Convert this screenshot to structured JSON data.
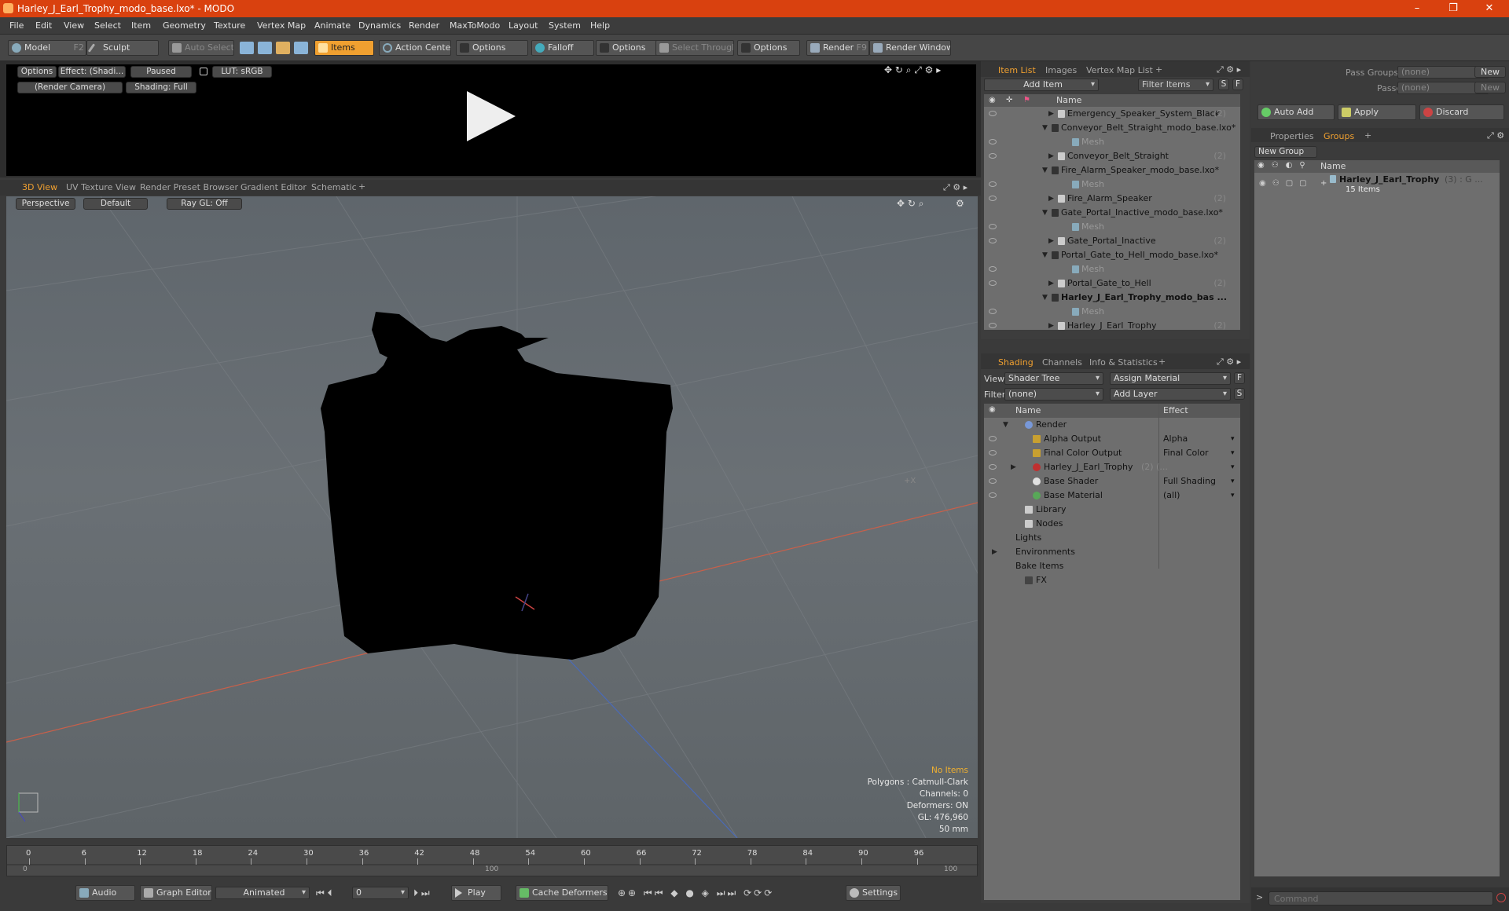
{
  "window": {
    "title": "Harley_J_Earl_Trophy_modo_base.lxo* - MODO",
    "minimize": "–",
    "restore": "❐",
    "close": "✕"
  },
  "menu": [
    "File",
    "Edit",
    "View",
    "Select",
    "Item",
    "Geometry",
    "Texture",
    "Vertex Map",
    "Animate",
    "Dynamics",
    "Render",
    "MaxToModo",
    "Layout",
    "System",
    "Help"
  ],
  "toolbar": {
    "model": "Model",
    "model_key": "F2",
    "sculpt": "Sculpt",
    "auto_select": "Auto Select",
    "items": "Items",
    "action_center": "Action Center",
    "options1": "Options",
    "falloff": "Falloff",
    "options2": "Options",
    "select_through": "Select Through",
    "options3": "Options",
    "render": "Render",
    "render_key": "F9",
    "render_window": "Render Window"
  },
  "preview": {
    "options": "Options",
    "effect": "Effect: (Shadi...",
    "paused": "Paused",
    "lut": "LUT: sRGB",
    "camera": "(Render Camera)",
    "shading": "Shading: Full"
  },
  "view_tabs": [
    "3D View",
    "UV Texture View",
    "Render Preset Browser",
    "Gradient Editor",
    "Schematic",
    "+"
  ],
  "viewport": {
    "perspective": "Perspective",
    "default": "Default",
    "raygl": "Ray GL: Off",
    "info": {
      "items": "No Items",
      "polygons": "Polygons : Catmull-Clark",
      "channels": "Channels: 0",
      "deformers": "Deformers: ON",
      "gl": "GL: 476,960",
      "size": "50 mm"
    }
  },
  "timeline": {
    "ticks": [
      "0",
      "6",
      "12",
      "18",
      "24",
      "30",
      "36",
      "42",
      "48",
      "54",
      "60",
      "66",
      "72",
      "78",
      "84",
      "90",
      "96"
    ],
    "sub": [
      "0",
      "100",
      "100"
    ]
  },
  "transport": {
    "audio": "Audio",
    "graph_editor": "Graph Editor",
    "animated": "Animated",
    "frame": "0",
    "play": "Play",
    "cache": "Cache Deformers",
    "settings": "Settings"
  },
  "item_list": {
    "tabs": [
      "Item List",
      "Images",
      "Vertex Map List",
      "+"
    ],
    "add_item": "Add Item",
    "filter": "Filter Items",
    "s": "S",
    "f": "F",
    "col_name": "Name",
    "rows": [
      {
        "label": "Emergency_Speaker_System_Black",
        "count": "(2)"
      },
      {
        "label": "Conveyor_Belt_Straight_modo_base.lxo*",
        "count": ""
      },
      {
        "label": "Mesh",
        "count": ""
      },
      {
        "label": "Conveyor_Belt_Straight",
        "count": "(2)"
      },
      {
        "label": "Fire_Alarm_Speaker_modo_base.lxo*",
        "count": ""
      },
      {
        "label": "Mesh",
        "count": ""
      },
      {
        "label": "Fire_Alarm_Speaker",
        "count": "(2)"
      },
      {
        "label": "Gate_Portal_Inactive_modo_base.lxo*",
        "count": ""
      },
      {
        "label": "Mesh",
        "count": ""
      },
      {
        "label": "Gate_Portal_Inactive",
        "count": "(2)"
      },
      {
        "label": "Portal_Gate_to_Hell_modo_base.lxo*",
        "count": ""
      },
      {
        "label": "Mesh",
        "count": ""
      },
      {
        "label": "Portal_Gate_to_Hell",
        "count": "(2)"
      },
      {
        "label": "Harley_J_Earl_Trophy_modo_bas ...",
        "count": ""
      },
      {
        "label": "Mesh",
        "count": ""
      },
      {
        "label": "Harley_J_Earl_Trophy",
        "count": "(2)"
      }
    ]
  },
  "shading": {
    "tabs": [
      "Shading",
      "Channels",
      "Info & Statistics",
      "+"
    ],
    "view_label": "View",
    "view_value": "Shader Tree",
    "assign": "Assign Material",
    "f": "F",
    "filter_label": "Filter",
    "filter_value": "(none)",
    "add_layer": "Add Layer",
    "s": "S",
    "col_name": "Name",
    "col_effect": "Effect",
    "rows": [
      {
        "label": "Render",
        "effect": ""
      },
      {
        "label": "Alpha Output",
        "effect": "Alpha"
      },
      {
        "label": "Final Color Output",
        "effect": "Final Color"
      },
      {
        "label": "Harley_J_Earl_Trophy",
        "extra": "(2) (...",
        "effect": ""
      },
      {
        "label": "Base Shader",
        "effect": "Full Shading"
      },
      {
        "label": "Base Material",
        "effect": "(all)"
      },
      {
        "label": "Library",
        "effect": ""
      },
      {
        "label": "Nodes",
        "effect": ""
      },
      {
        "label": "Lights",
        "effect": ""
      },
      {
        "label": "Environments",
        "effect": ""
      },
      {
        "label": "Bake Items",
        "effect": ""
      },
      {
        "label": "FX",
        "effect": ""
      }
    ]
  },
  "groups": {
    "pass_groups": "Pass Groups",
    "passes": "Passes",
    "none1": "(none)",
    "none2": "(none)",
    "new1": "New",
    "new2": "New",
    "auto_add": "Auto Add",
    "apply": "Apply",
    "discard": "Discard",
    "tabs": [
      "Properties",
      "Groups",
      "+"
    ],
    "new_group": "New Group",
    "col_name": "Name",
    "group_name": "Harley_J_Earl_Trophy",
    "group_suffix": "(3) : G ...",
    "group_items": "15 Items"
  },
  "command": {
    "placeholder": "Command",
    "prompt": ">"
  }
}
